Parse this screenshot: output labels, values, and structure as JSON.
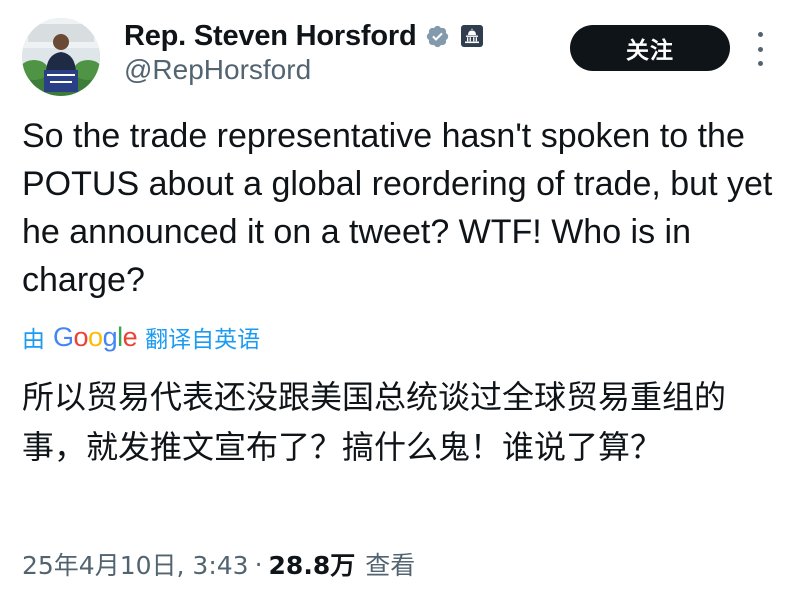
{
  "author": {
    "display_name": "Rep. Steven Horsford",
    "handle": "@RepHorsford",
    "verified_badge_icon": "verified-badge-icon",
    "affiliation_icon": "capitol-building-icon",
    "avatar_sign_text": "Break the Cycle of Violence"
  },
  "actions": {
    "follow_label": "关注",
    "more_icon": "more-options-icon"
  },
  "tweet": {
    "text": "So the trade representative hasn't spoken to the POTUS about a global reordering of trade, but yet he announced it on a tweet? WTF! Who is in charge?"
  },
  "translation": {
    "by_label": "由",
    "provider": [
      "G",
      "o",
      "o",
      "g",
      "l",
      "e"
    ],
    "action_label": "翻译自英语",
    "text": "所以贸易代表还没跟美国总统谈过全球贸易重组的事，就发推文宣布了？搞什么鬼！谁说了算？"
  },
  "meta": {
    "timestamp": "25年4月10日, 3:43",
    "separator": "·",
    "views_count": "28.8万",
    "views_label": "查看"
  },
  "colors": {
    "text_primary": "#0f1419",
    "text_secondary": "#536471",
    "link_blue": "#1d9bf0",
    "follow_button_bg": "#0f1419",
    "google_blue": "#4285f4",
    "google_red": "#ea4335",
    "google_yellow": "#fbbc05",
    "google_green": "#34a853"
  }
}
